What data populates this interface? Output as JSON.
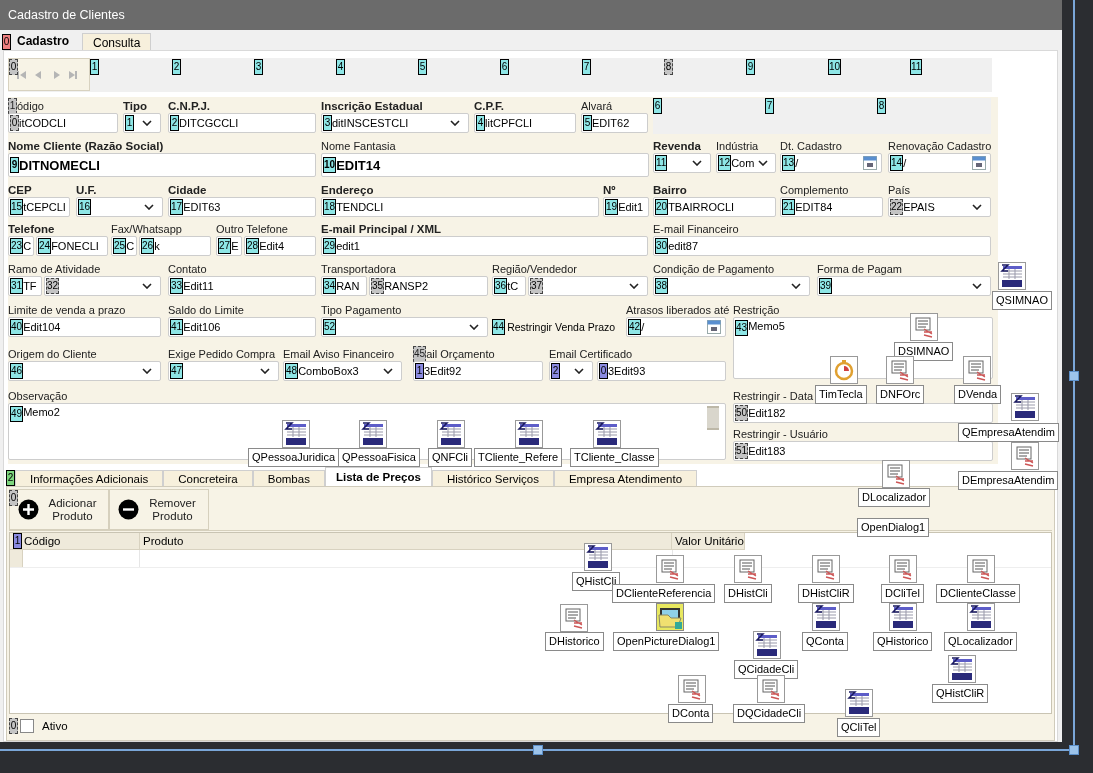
{
  "window": {
    "title": "Cadastro de Clientes"
  },
  "page_tabs": {
    "marker": {
      "text": "0",
      "color": "#ee8080",
      "hidden": false
    },
    "tabs": [
      {
        "label": "Cadastro",
        "selected": true
      },
      {
        "label": "Consulta",
        "selected": false
      }
    ]
  },
  "navigator": {
    "marker": {
      "text": "0",
      "color": "#c4c4c4",
      "hidden": true
    },
    "panel_markers": [
      {
        "text": "1",
        "color": "#8ee6e6",
        "hidden": false
      },
      {
        "text": "2",
        "color": "#8ee6e6",
        "hidden": false
      },
      {
        "text": "3",
        "color": "#8ee6e6",
        "hidden": false
      },
      {
        "text": "4",
        "color": "#8ee6e6",
        "hidden": false
      },
      {
        "text": "5",
        "color": "#8ee6e6",
        "hidden": false
      },
      {
        "text": "6",
        "color": "#8ee6e6",
        "hidden": false
      },
      {
        "text": "7",
        "color": "#8ee6e6",
        "hidden": false
      },
      {
        "text": "8",
        "color": "#c4c4c4",
        "hidden": true
      },
      {
        "text": "9",
        "color": "#8ee6e6",
        "hidden": false
      },
      {
        "text": "10",
        "color": "#8ee6e6",
        "hidden": false
      },
      {
        "text": "11",
        "color": "#8ee6e6",
        "hidden": false
      }
    ]
  },
  "rows": [
    {
      "columns": [
        {
          "kind": "field",
          "label": "ódigo",
          "label_marker": {
            "text": "1",
            "color": "#c4c4c4",
            "hidden": true
          },
          "bold": false,
          "controls": [
            {
              "kind": "edit",
              "marker": {
                "text": "0",
                "color": "#c4c4c4",
                "hidden": true
              },
              "value": "itCODCLI"
            }
          ]
        },
        {
          "kind": "field",
          "label": "Tipo",
          "bold": true,
          "controls": [
            {
              "kind": "combo",
              "marker": {
                "text": "1",
                "color": "#8ee6e6",
                "hidden": false
              }
            }
          ]
        },
        {
          "kind": "field",
          "label": "C.N.P.J.",
          "bold": true,
          "controls": [
            {
              "kind": "edit",
              "marker": {
                "text": "2",
                "color": "#8ee6e6",
                "hidden": false
              },
              "value": "DITCGCCLI"
            }
          ]
        },
        {
          "kind": "field",
          "label": "Inscrição Estadual",
          "bold": true,
          "controls": [
            {
              "kind": "combo",
              "marker": {
                "text": "3",
                "color": "#8ee6e6",
                "hidden": false
              },
              "value": "ditINSCESTCLI"
            }
          ]
        },
        {
          "kind": "field",
          "label": "C.P.F.",
          "bold": true,
          "controls": [
            {
              "kind": "edit",
              "marker": {
                "text": "4",
                "color": "#8ee6e6",
                "hidden": false
              },
              "value": "litCPFCLI"
            }
          ]
        },
        {
          "kind": "field",
          "label": "Alvará",
          "bold": false,
          "controls": [
            {
              "kind": "edit",
              "marker": {
                "text": "5",
                "color": "#8ee6e6",
                "hidden": false
              },
              "value": "EDIT62"
            }
          ]
        },
        {
          "kind": "marker_panel",
          "markers": [
            {
              "text": "6",
              "color": "#8ee6e6",
              "hidden": false
            },
            {
              "text": "7",
              "color": "#8ee6e6",
              "hidden": false
            },
            {
              "text": "8",
              "color": "#8ee6e6",
              "hidden": false
            }
          ]
        }
      ]
    },
    {
      "columns": [
        {
          "kind": "field",
          "label": "Nome Cliente (Razão Social)",
          "bold": true,
          "controls": [
            {
              "kind": "edit",
              "marker": {
                "text": "9",
                "color": "#8ee6e6",
                "hidden": false
              },
              "value": "DITNOMECLI",
              "bold": true
            }
          ]
        },
        {
          "kind": "field",
          "label": "Nome Fantasia",
          "bold": false,
          "controls": [
            {
              "kind": "edit",
              "marker": {
                "text": "10",
                "color": "#8ee6e6",
                "hidden": false
              },
              "value": "EDIT14",
              "bold": true
            }
          ]
        },
        {
          "kind": "field",
          "label": "Revenda",
          "bold": true,
          "controls": [
            {
              "kind": "combo",
              "marker": {
                "text": "11",
                "color": "#8ee6e6",
                "hidden": false
              }
            }
          ]
        },
        {
          "kind": "field",
          "label": "Indústria",
          "bold": false,
          "controls": [
            {
              "kind": "combo",
              "marker": {
                "text": "12",
                "color": "#8ee6e6",
                "hidden": false
              },
              "value": "Com"
            }
          ]
        },
        {
          "kind": "field",
          "label": "Dt. Cadastro",
          "bold": false,
          "controls": [
            {
              "kind": "date",
              "marker": {
                "text": "13",
                "color": "#8ee6e6",
                "hidden": false
              },
              "value": "/"
            }
          ]
        },
        {
          "kind": "field",
          "label": "Renovação Cadastro",
          "bold": false,
          "controls": [
            {
              "kind": "date",
              "marker": {
                "text": "14",
                "color": "#8ee6e6",
                "hidden": false
              },
              "value": "/"
            }
          ]
        }
      ]
    },
    {
      "columns": [
        {
          "kind": "field",
          "label": "CEP",
          "bold": true,
          "controls": [
            {
              "kind": "edit",
              "marker": {
                "text": "15",
                "color": "#8ee6e6",
                "hidden": false
              },
              "value": "tCEPCLI"
            }
          ]
        },
        {
          "kind": "field",
          "label": "U.F.",
          "bold": true,
          "controls": [
            {
              "kind": "combo",
              "marker": {
                "text": "16",
                "color": "#8ee6e6",
                "hidden": false
              }
            }
          ]
        },
        {
          "kind": "field",
          "label": "Cidade",
          "bold": true,
          "controls": [
            {
              "kind": "edit",
              "marker": {
                "text": "17",
                "color": "#8ee6e6",
                "hidden": false
              },
              "value": "EDIT63"
            }
          ]
        },
        {
          "kind": "field",
          "label": "Endereço",
          "bold": true,
          "controls": [
            {
              "kind": "edit",
              "marker": {
                "text": "18",
                "color": "#8ee6e6",
                "hidden": false
              },
              "value": "TENDCLI"
            }
          ]
        },
        {
          "kind": "field",
          "label": "Nº",
          "bold": true,
          "controls": [
            {
              "kind": "edit",
              "marker": {
                "text": "19",
                "color": "#8ee6e6",
                "hidden": false
              },
              "value": "Edit1"
            }
          ]
        },
        {
          "kind": "field",
          "label": "Bairro",
          "bold": true,
          "controls": [
            {
              "kind": "edit",
              "marker": {
                "text": "20",
                "color": "#8ee6e6",
                "hidden": false
              },
              "value": "TBAIRROCLI"
            }
          ]
        },
        {
          "kind": "field",
          "label": "Complemento",
          "bold": false,
          "controls": [
            {
              "kind": "edit",
              "marker": {
                "text": "21",
                "color": "#8ee6e6",
                "hidden": false
              },
              "value": "EDIT84"
            }
          ]
        },
        {
          "kind": "field",
          "label": "País",
          "bold": false,
          "controls": [
            {
              "kind": "combo",
              "marker": {
                "text": "22",
                "color": "#c4c4c4",
                "hidden": true
              },
              "value": "EPAIS"
            }
          ]
        }
      ]
    },
    {
      "columns": [
        {
          "kind": "field",
          "label": "Telefone",
          "bold": true,
          "controls": [
            {
              "kind": "edit",
              "marker": {
                "text": "23",
                "color": "#8ee6e6",
                "hidden": false
              },
              "value": "C"
            },
            {
              "kind": "edit",
              "marker": {
                "text": "24",
                "color": "#8ee6e6",
                "hidden": false
              },
              "value": "FONECLI"
            }
          ]
        },
        {
          "kind": "field",
          "label": "Fax/Whatsapp",
          "bold": false,
          "controls": [
            {
              "kind": "edit",
              "marker": {
                "text": "25",
                "color": "#8ee6e6",
                "hidden": false
              },
              "value": "C"
            },
            {
              "kind": "edit",
              "marker": {
                "text": "26",
                "color": "#8ee6e6",
                "hidden": false
              },
              "value": "k"
            }
          ]
        },
        {
          "kind": "field",
          "label": "Outro Telefone",
          "bold": false,
          "controls": [
            {
              "kind": "edit",
              "marker": {
                "text": "27",
                "color": "#8ee6e6",
                "hidden": false
              },
              "value": "E"
            },
            {
              "kind": "edit",
              "marker": {
                "text": "28",
                "color": "#8ee6e6",
                "hidden": false
              },
              "value": "Edit4"
            }
          ]
        },
        {
          "kind": "field",
          "label": "E-mail Principal / XML",
          "bold": true,
          "controls": [
            {
              "kind": "edit",
              "marker": {
                "text": "29",
                "color": "#8ee6e6",
                "hidden": false
              },
              "value": "edit1"
            }
          ]
        },
        {
          "kind": "field",
          "label": "E-mail Financeiro",
          "bold": false,
          "controls": [
            {
              "kind": "edit",
              "marker": {
                "text": "30",
                "color": "#8ee6e6",
                "hidden": false
              },
              "value": "edit87"
            }
          ]
        }
      ]
    },
    {
      "columns": [
        {
          "kind": "field",
          "label": "Ramo de Atividade",
          "bold": false,
          "controls": [
            {
              "kind": "edit",
              "marker": {
                "text": "31",
                "color": "#8ee6e6",
                "hidden": false
              },
              "value": "TF"
            },
            {
              "kind": "combo",
              "marker": {
                "text": "32",
                "color": "#c4c4c4",
                "hidden": true
              }
            }
          ]
        },
        {
          "kind": "field",
          "label": "Contato",
          "bold": false,
          "controls": [
            {
              "kind": "edit",
              "marker": {
                "text": "33",
                "color": "#8ee6e6",
                "hidden": false
              },
              "value": "Edit11"
            }
          ]
        },
        {
          "kind": "field",
          "label": "Transportadora",
          "bold": false,
          "controls": [
            {
              "kind": "edit",
              "marker": {
                "text": "34",
                "color": "#8ee6e6",
                "hidden": false
              },
              "value": "RAN"
            },
            {
              "kind": "edit",
              "marker": {
                "text": "35",
                "color": "#c4c4c4",
                "hidden": true
              },
              "value": "RANSP2"
            }
          ]
        },
        {
          "kind": "field",
          "label": "Região/Vendedor",
          "bold": false,
          "controls": [
            {
              "kind": "edit",
              "marker": {
                "text": "36",
                "color": "#8ee6e6",
                "hidden": false
              },
              "value": "tC"
            },
            {
              "kind": "combo",
              "marker": {
                "text": "37",
                "color": "#c4c4c4",
                "hidden": true
              }
            }
          ]
        },
        {
          "kind": "field",
          "label": "Condição de Pagamento",
          "bold": false,
          "controls": [
            {
              "kind": "combo",
              "marker": {
                "text": "38",
                "color": "#8ee6e6",
                "hidden": false
              }
            }
          ]
        },
        {
          "kind": "field",
          "label": "Forma de Pagam",
          "bold": false,
          "controls": [
            {
              "kind": "combo",
              "marker": {
                "text": "39",
                "color": "#8ee6e6",
                "hidden": false
              }
            }
          ]
        }
      ]
    },
    {
      "columns": [
        {
          "kind": "field",
          "label": "Limite de venda a prazo",
          "bold": false,
          "controls": [
            {
              "kind": "edit",
              "marker": {
                "text": "40",
                "color": "#8ee6e6",
                "hidden": false
              },
              "value": "Edit104"
            }
          ]
        },
        {
          "kind": "field",
          "label": "Saldo do Limite",
          "bold": false,
          "controls": [
            {
              "kind": "edit",
              "marker": {
                "text": "41",
                "color": "#8ee6e6",
                "hidden": false
              },
              "value": "Edit106"
            }
          ]
        },
        {
          "kind": "field",
          "label": "Tipo Pagamento",
          "bold": false,
          "controls": [
            {
              "kind": "combo",
              "marker": {
                "text": "52",
                "color": "#8ee6e6",
                "hidden": false
              }
            }
          ]
        },
        {
          "kind": "field",
          "controls": [
            {
              "kind": "checkbox",
              "marker": {
                "text": "44",
                "color": "#8ee6e6",
                "hidden": false
              },
              "value": "Restringir Venda Prazo",
              "checked": false
            }
          ]
        },
        {
          "kind": "field",
          "label": "Atrasos liberados até",
          "bold": false,
          "controls": [
            {
              "kind": "date",
              "marker": {
                "text": "42",
                "color": "#8ee6e6",
                "hidden": false
              },
              "value": "/"
            }
          ]
        },
        {
          "kind": "field",
          "label": "Restrição",
          "bold": false,
          "controls": [
            {
              "kind": "memo",
              "marker": {
                "text": "43",
                "color": "#8ee6e6",
                "hidden": false
              },
              "value": "Memo5"
            }
          ]
        }
      ]
    },
    {
      "columns": [
        {
          "kind": "field",
          "label": "Origem do Cliente",
          "bold": false,
          "controls": [
            {
              "kind": "combo",
              "marker": {
                "text": "46",
                "color": "#8ee6e6",
                "hidden": false
              }
            }
          ]
        },
        {
          "kind": "field",
          "label": "Exige Pedido Compra",
          "bold": false,
          "controls": [
            {
              "kind": "combo",
              "marker": {
                "text": "47",
                "color": "#8ee6e6",
                "hidden": false
              }
            }
          ]
        },
        {
          "kind": "field",
          "label": "Email Aviso Financeiro",
          "bold": false,
          "controls": [
            {
              "kind": "combo",
              "marker": {
                "text": "48",
                "color": "#8ee6e6",
                "hidden": false
              },
              "value": "ComboBox3"
            }
          ]
        },
        {
          "kind": "field",
          "label": "ail Orçamento",
          "label_marker": {
            "text": "45",
            "color": "#c4c4c4",
            "hidden": true
          },
          "bold": false,
          "controls": [
            {
              "kind": "edit",
              "marker": {
                "text": "1",
                "color": "#8a8ae0",
                "hidden": false
              },
              "value": "3Edit92"
            }
          ]
        },
        {
          "kind": "field",
          "label": "Email Certificado",
          "bold": false,
          "controls": [
            {
              "kind": "combo",
              "marker": {
                "text": "2",
                "color": "#8a8ae0",
                "hidden": false
              }
            }
          ]
        },
        {
          "kind": "field",
          "controls": [
            {
              "kind": "edit",
              "marker": {
                "text": "0",
                "color": "#8a8ae0",
                "hidden": false
              },
              "value": "3Edit93"
            }
          ]
        }
      ]
    },
    {
      "columns": [
        {
          "kind": "field",
          "label": "Observação",
          "bold": false,
          "controls": [
            {
              "kind": "memo",
              "marker": {
                "text": "49",
                "color": "#8ee6e6",
                "hidden": false
              },
              "value": "Memo2",
              "scrollbar": true
            }
          ]
        },
        {
          "kind": "stack",
          "fields": [
            {
              "label": "Restringir - Data",
              "control": {
                "kind": "edit",
                "marker": {
                  "text": "50",
                  "color": "#c4c4c4",
                  "hidden": true
                },
                "value": "Edit182"
              }
            },
            {
              "label": "Restringir - Usuário",
              "control": {
                "kind": "edit",
                "marker": {
                  "text": "51",
                  "color": "#c4c4c4",
                  "hidden": true
                },
                "value": "Edit183"
              }
            }
          ]
        }
      ]
    }
  ],
  "detail_tabs": {
    "marker": {
      "text": "2",
      "color": "#7ed67e",
      "hidden": false
    },
    "tabs": [
      {
        "label": "Informações Adicionais",
        "selected": false
      },
      {
        "label": "Concreteira",
        "selected": false
      },
      {
        "label": "Bombas",
        "selected": false
      },
      {
        "label": "Lista de Preços",
        "selected": true
      },
      {
        "label": "Histórico Serviços",
        "selected": false
      },
      {
        "label": "Empresa Atendimento",
        "selected": false
      }
    ]
  },
  "toolbar": {
    "marker": {
      "text": "0",
      "color": "#c4c4c4",
      "hidden": true
    },
    "buttons": [
      {
        "kind": "add",
        "label": "Adicionar Produto"
      },
      {
        "kind": "remove",
        "label": "Remover Produto"
      }
    ]
  },
  "grid": {
    "marker": {
      "text": "1",
      "color": "#8a8ae0",
      "hidden": false
    },
    "columns": [
      "Código",
      "Produto",
      "Valor Unitário"
    ]
  },
  "active_checkbox": {
    "marker": {
      "text": "0",
      "color": "#c4c4c4",
      "hidden": true
    },
    "label": "Ativo",
    "checked": false
  },
  "components": [
    {
      "kind": "sql",
      "name": "QSIMNAO"
    },
    {
      "kind": "datasource",
      "name": "DSIMNAO"
    },
    {
      "kind": "timer",
      "name": "TimTecla"
    },
    {
      "kind": "datasource",
      "name": "DNFOrc"
    },
    {
      "kind": "datasource",
      "name": "DVenda"
    },
    {
      "kind": "sql",
      "name": "QEmpresaAtendim"
    },
    {
      "kind": "sql",
      "name": "QPessoaJuridica"
    },
    {
      "kind": "sql",
      "name": "QPessoaFisica"
    },
    {
      "kind": "sql",
      "name": "QNFCli"
    },
    {
      "kind": "sql",
      "name": "TCliente_Refere"
    },
    {
      "kind": "sql",
      "name": "TCliente_Classe"
    },
    {
      "kind": "datasource",
      "name": "DEmpresaAtendim"
    },
    {
      "kind": "datasource",
      "name": "DLocalizador"
    },
    {
      "kind": "dialog",
      "name": "OpenDialog1"
    },
    {
      "kind": "sql",
      "name": "QHistCli"
    },
    {
      "kind": "datasource",
      "name": "DClienteReferencia"
    },
    {
      "kind": "datasource",
      "name": "DHistCli"
    },
    {
      "kind": "datasource",
      "name": "DHistCliR"
    },
    {
      "kind": "datasource",
      "name": "DCliTel"
    },
    {
      "kind": "datasource",
      "name": "DClienteClasse"
    },
    {
      "kind": "datasource",
      "name": "DHistorico"
    },
    {
      "kind": "picture_dialog",
      "name": "OpenPictureDialog1"
    },
    {
      "kind": "sql",
      "name": "QConta"
    },
    {
      "kind": "sql",
      "name": "QHistorico"
    },
    {
      "kind": "sql",
      "name": "QLocalizador"
    },
    {
      "kind": "sql",
      "name": "QCidadeCli"
    },
    {
      "kind": "sql",
      "name": "QHistCliR"
    },
    {
      "kind": "datasource",
      "name": "DConta"
    },
    {
      "kind": "datasource",
      "name": "DQCidadeCli"
    },
    {
      "kind": "sql",
      "name": "QCliTel"
    }
  ]
}
